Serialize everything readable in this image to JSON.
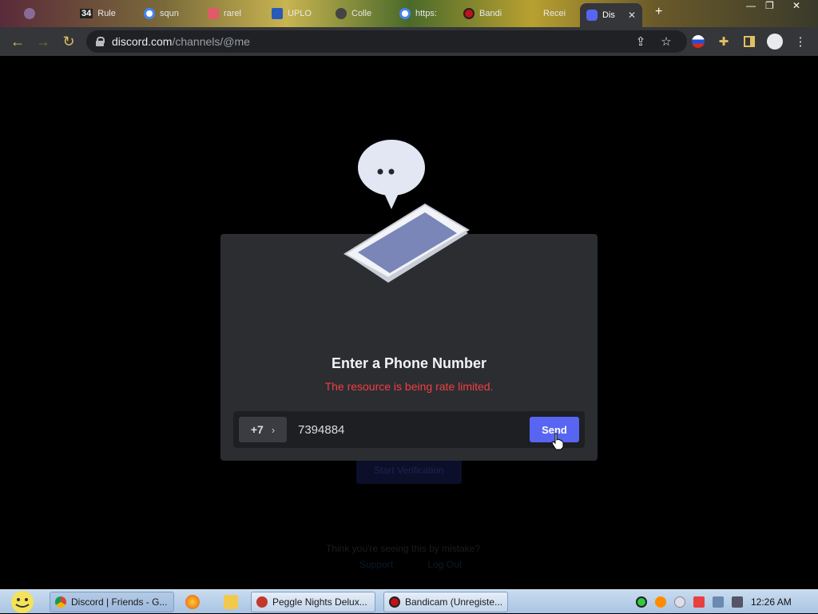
{
  "browser": {
    "tabs": [
      {
        "label": "",
        "favicon_color": "#8a6a9a"
      },
      {
        "label": "Rule",
        "favicon_color": "#333333"
      },
      {
        "label": "squn",
        "favicon_color": "#4285f4"
      },
      {
        "label": "rarel",
        "favicon_color": "#e05a6a"
      },
      {
        "label": "UPLO",
        "favicon_color": "#2a5ab8"
      },
      {
        "label": "Colle",
        "favicon_color": "#444444"
      },
      {
        "label": "https:",
        "favicon_color": "#4285f4"
      },
      {
        "label": "Bandi",
        "favicon_color": "#c0121a"
      },
      {
        "label": "Recei",
        "favicon_color": "#666666"
      },
      {
        "label": "Dis",
        "favicon_color": "#5865f2"
      }
    ],
    "tab_counter": "34",
    "url_host": "discord.com",
    "url_path": "/channels/@me"
  },
  "page": {
    "modal": {
      "title": "Enter a Phone Number",
      "error": "The resource is being rate limited.",
      "country_code": "+7",
      "phone_value": "7394884",
      "send_label": "Send"
    },
    "background": {
      "verify_button": "Start Verification",
      "mistake_text": "Think you're seeing this by mistake?",
      "support_link": "Support",
      "logout_link": "Log Out"
    }
  },
  "taskbar": {
    "items": [
      {
        "label": "Discord | Friends - G...",
        "icon_color": "#4285f4"
      },
      {
        "label": "Peggle Nights Delux...",
        "icon_color": "#c0392b"
      },
      {
        "label": "Bandicam (Unregiste...",
        "icon_color": "#c0121a"
      }
    ],
    "clock": "12:26 AM"
  },
  "colors": {
    "accent": "#5865f2",
    "error": "#f23f43",
    "modal_bg": "#2b2d31",
    "input_bg": "#1e1f22"
  }
}
